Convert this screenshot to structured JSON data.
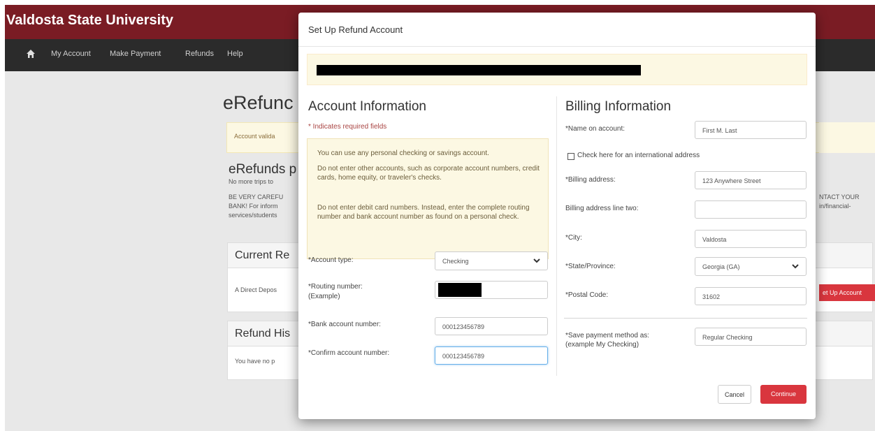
{
  "app": {
    "brand": "Valdosta State University"
  },
  "nav": {
    "home_icon": "home-icon",
    "items": [
      "My Account",
      "Make Payment",
      "Refunds",
      "Help"
    ]
  },
  "background": {
    "title": "eRefunc",
    "alert": "Account valida",
    "section_title": "eRefunds p",
    "line1": "No more trips to",
    "line2": "BE VERY CAREFU",
    "line3": "BANK! For inform",
    "line4": "services/students",
    "right_line1": "NTACT YOUR",
    "right_line2": "in/financial-",
    "panel1_title": "Current Re",
    "panel1_body": "A Direct Depos",
    "panel2_title": "Refund His",
    "panel2_body": "You have no p",
    "setup_button": "et Up Account"
  },
  "modal": {
    "title": "Set Up Refund Account",
    "account": {
      "heading": "Account Information",
      "required_note": "* Indicates required fields",
      "info": [
        "You can use any personal checking or savings account.",
        "Do not enter other accounts, such as corporate account numbers, credit cards, home equity, or traveler's checks.",
        "Do not enter debit card numbers. Instead, enter the complete routing number and bank account number as found on a personal check."
      ],
      "account_type_label": "*Account type:",
      "account_type_value": "Checking",
      "routing_label": "*Routing number:",
      "routing_example": "(Example)",
      "bank_account_label": "*Bank account number:",
      "bank_account_value": "000123456789",
      "confirm_label": "*Confirm account number:",
      "confirm_value": "000123456789"
    },
    "billing": {
      "heading": "Billing Information",
      "name_label": "*Name on account:",
      "name_value": "First M. Last",
      "intl_label": "Check here for an international address",
      "address_label": "*Billing address:",
      "address_value": "123 Anywhere Street",
      "address2_label": "Billing address line two:",
      "address2_value": "",
      "city_label": "*City:",
      "city_value": "Valdosta",
      "state_label": "*State/Province:",
      "state_value": "Georgia (GA)",
      "postal_label": "*Postal Code:",
      "postal_value": "31602",
      "save_label_1": "*Save payment method as:",
      "save_label_2": "(example My Checking)",
      "save_value": "Regular Checking"
    },
    "buttons": {
      "cancel": "Cancel",
      "continue": "Continue"
    }
  },
  "colors": {
    "brand_bar": "#7a1c24",
    "nav_bar": "#2b2b2b",
    "accent_red": "#d9363e",
    "warning_bg": "#fcf8e3"
  }
}
